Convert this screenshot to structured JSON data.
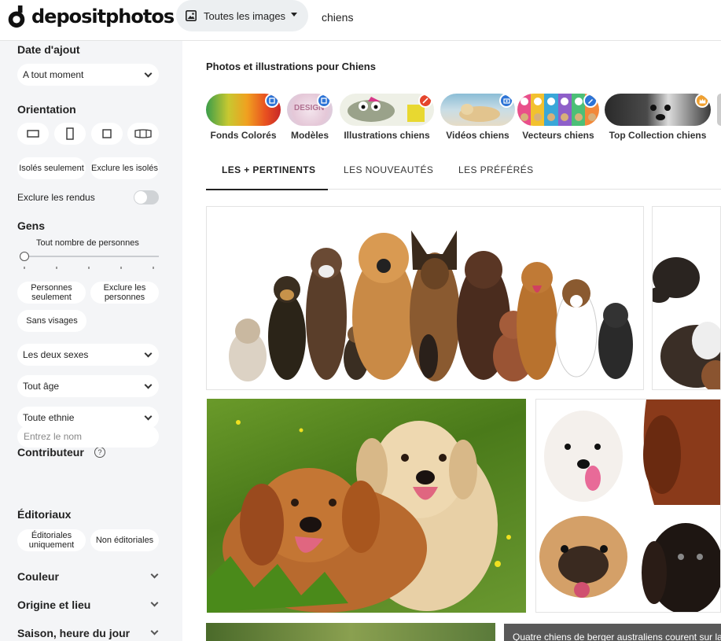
{
  "header": {
    "logo_text": "depositphotos",
    "type_select": "Toutes les images",
    "search_value": "chiens"
  },
  "sidebar": {
    "date_title": "Date d'ajout",
    "date_value": "A tout moment",
    "orientation_title": "Orientation",
    "isolated_only": "Isolés seulement",
    "exclude_isolated": "Exclure les isolés",
    "exclude_renders": "Exclure les rendus",
    "people_title": "Gens",
    "people_count": "Tout nombre de personnes",
    "people_only": "Personnes seulement",
    "exclude_people": "Exclure les personnes",
    "no_faces": "Sans visages",
    "gender_value": "Les deux sexes",
    "age_value": "Tout âge",
    "ethnicity_value": "Toute ethnie",
    "contributor_title": "Contributeur",
    "contributor_placeholder": "Entrez le nom",
    "editorial_title": "Éditoriaux",
    "editorial_only": "Éditoriales uniquement",
    "non_editorial": "Non éditoriales",
    "color_title": "Couleur",
    "origin_title": "Origine et lieu",
    "season_title": "Saison, heure du jour"
  },
  "main": {
    "title": "Photos et illustrations pour Chiens",
    "chips": [
      {
        "label": "Fonds Colorés",
        "badge_icon": "copy-icon",
        "badge_color": "#2d74d6"
      },
      {
        "label": "Modèles",
        "badge_icon": "copy-icon",
        "badge_color": "#2d74d6"
      },
      {
        "label": "Illustrations chiens",
        "badge_icon": "brush-icon",
        "badge_color": "#e5452c"
      },
      {
        "label": "Vidéos chiens",
        "badge_icon": "camera-icon",
        "badge_color": "#2d74d6"
      },
      {
        "label": "Vecteurs chiens",
        "badge_icon": "pen-icon",
        "badge_color": "#2d74d6"
      },
      {
        "label": "Top Collection chiens",
        "badge_icon": "crown-icon",
        "badge_color": "#f0a030"
      }
    ],
    "tabs": [
      "LES + PERTINENTS",
      "LES NOUVEAUTÉS",
      "LES PRÉFÉRÉS"
    ],
    "active_tab": 0,
    "caption": "Quatre chiens de berger australiens courent sur la"
  }
}
